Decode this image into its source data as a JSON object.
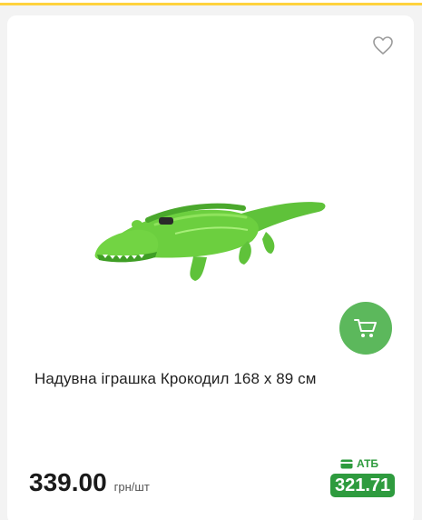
{
  "product": {
    "title": "Надувна іграшка Крокодил 168 x 89 см",
    "price": "339.00",
    "unit": "грн/шт",
    "loyalty_label": "АТБ",
    "loyalty_price": "321.71",
    "image_description_icon": "crocodile-image"
  },
  "icons": {
    "favorite": "heart-icon",
    "cart": "cart-icon",
    "loyalty": "card-icon"
  },
  "colors": {
    "accent_green": "#5cb85c",
    "atb_green": "#2e9b3e",
    "top_border": "#ffd23d"
  }
}
